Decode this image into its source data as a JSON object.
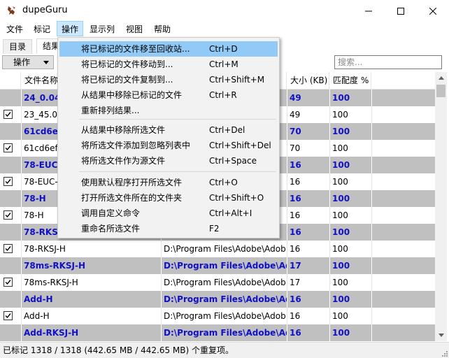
{
  "window": {
    "title": "dupeGuru"
  },
  "menubar": [
    "文件",
    "标记",
    "操作",
    "显示列",
    "视图",
    "帮助"
  ],
  "tabs": [
    "目录",
    "结果"
  ],
  "toolbar": {
    "action_label": "操作",
    "search_placeholder": "搜索..."
  },
  "table": {
    "columns": [
      "文件名称",
      "大小 (KB)",
      "匹配度 %"
    ],
    "rows": [
      {
        "name": "24_0.049",
        "folder": "",
        "size": "49",
        "match": "100",
        "ref": true,
        "checked": false
      },
      {
        "name": "23_45.049",
        "folder": "",
        "size": "49",
        "match": "100",
        "ref": false,
        "checked": true
      },
      {
        "name": "61cd6ef",
        "folder": "",
        "size": "70",
        "match": "100",
        "ref": true,
        "checked": false
      },
      {
        "name": "61cd6ef8",
        "folder": "",
        "size": "70",
        "match": "100",
        "ref": false,
        "checked": true
      },
      {
        "name": "78-EUC-",
        "folder": "",
        "size": "16",
        "match": "100",
        "ref": true,
        "checked": false
      },
      {
        "name": "78-EUC-H",
        "folder": "",
        "size": "16",
        "match": "100",
        "ref": false,
        "checked": true
      },
      {
        "name": "78-H",
        "folder": "",
        "size": "16",
        "match": "100",
        "ref": true,
        "checked": false
      },
      {
        "name": "78-H",
        "folder": "",
        "size": "16",
        "match": "100",
        "ref": false,
        "checked": true
      },
      {
        "name": "78-RKSJ",
        "folder": "",
        "size": "16",
        "match": "100",
        "ref": true,
        "checked": false
      },
      {
        "name": "78-RKSJ-H",
        "folder": "D:\\Program Files\\Adobe\\Adob...",
        "size": "16",
        "match": "100",
        "ref": false,
        "checked": true
      },
      {
        "name": "78ms-RKSJ-H",
        "folder": "D:\\Program Files\\Adobe\\Ado...",
        "size": "17",
        "match": "100",
        "ref": true,
        "checked": false
      },
      {
        "name": "78ms-RKSJ-H",
        "folder": "D:\\Program Files\\Adobe\\Adob...",
        "size": "17",
        "match": "100",
        "ref": false,
        "checked": true
      },
      {
        "name": "Add-H",
        "folder": "D:\\Program Files\\Adobe\\Ado...",
        "size": "16",
        "match": "100",
        "ref": true,
        "checked": false
      },
      {
        "name": "Add-H",
        "folder": "D:\\Program Files\\Adobe\\Adob...",
        "size": "16",
        "match": "100",
        "ref": false,
        "checked": true
      },
      {
        "name": "Add-RKSJ-H",
        "folder": "D:\\Program Files\\Adobe\\Ado...",
        "size": "16",
        "match": "100",
        "ref": true,
        "checked": false
      }
    ]
  },
  "status": "已标记 1318 / 1318 (442.65 MB / 442.65 MB) 个重复项。",
  "dropdown": {
    "groups": [
      [
        {
          "label": "将已标记的文件移至回收站...",
          "shortcut": "Ctrl+D",
          "highlighted": true
        },
        {
          "label": "将已标记的文件移动到...",
          "shortcut": "Ctrl+M"
        },
        {
          "label": "将已标记的文件复制到...",
          "shortcut": "Ctrl+Shift+M"
        },
        {
          "label": "从结果中移除已标记的文件",
          "shortcut": "Ctrl+R"
        },
        {
          "label": "重新排列结果...",
          "shortcut": ""
        }
      ],
      [
        {
          "label": "从结果中移除所选文件",
          "shortcut": "Ctrl+Del"
        },
        {
          "label": "将所选文件添加到忽略列表中",
          "shortcut": "Ctrl+Shift+Del"
        },
        {
          "label": "将所选文件作为源文件",
          "shortcut": "Ctrl+Space"
        }
      ],
      [
        {
          "label": "使用默认程序打开所选文件",
          "shortcut": "Ctrl+O"
        },
        {
          "label": "打开所选文件所在的文件夹",
          "shortcut": "Ctrl+Shift+O"
        },
        {
          "label": "调用自定义命令",
          "shortcut": "Ctrl+Alt+I"
        },
        {
          "label": "重命名所选文件",
          "shortcut": "F2"
        }
      ]
    ]
  },
  "colors": {
    "ref_row_bg": "#c0c0c0",
    "ref_text": "#1010c8",
    "menu_highlight": "#91c9f7"
  },
  "icons": [
    "app-icon",
    "minimize-icon",
    "maximize-icon",
    "close-icon",
    "dropdown-arrow-icon",
    "scroll-up-icon",
    "scroll-down-icon",
    "size-grip-icon"
  ]
}
